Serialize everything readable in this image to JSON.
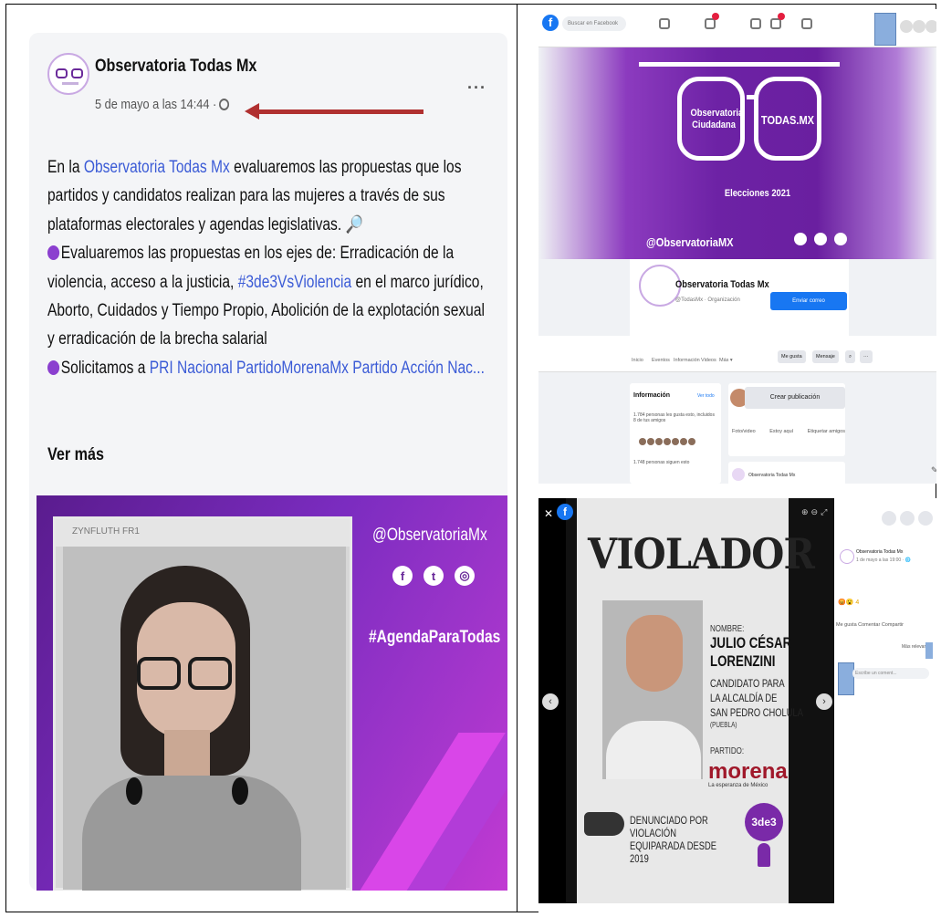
{
  "post": {
    "page_name": "Observatoria Todas Mx",
    "date": "5 de mayo a las 14:44 ·",
    "more_label": "···",
    "line1_pre": "En la ",
    "line1_link": "Observatoria Todas Mx",
    "line1_post": " evaluaremos las propuestas que los",
    "line2": "partidos y candidatos realizan para las mujeres a través de sus",
    "line3": "plataformas electorales y agendas legislativas. 🔎",
    "line4": "Evaluaremos las propuestas en los ejes de: Erradicación de la",
    "line5_pre": "violencia, acceso a la justicia, ",
    "line5_link": "#3de3VsViolencia",
    "line5_post": " en el marco jurídico,",
    "line6": "Aborto, Cuidados y Tiempo Propio, Abolición de la explotación sexual",
    "line7": "y erradicación de la brecha salarial",
    "line8_pre": "Solicitamos a ",
    "line8_link": "PRI Nacional PartidoMorenaMx Partido Acción Nac...",
    "see_more": "Ver más",
    "image_handle": "@ObservatoriaMx",
    "image_hashtag": "#AgendaParaTodas",
    "video_bar_text": "ZYNFLUTH FR1"
  },
  "fb_page": {
    "search_placeholder": "Buscar en Facebook",
    "cover_text_left": "Observatoria Ciudadana",
    "cover_text_right": "TODAS.MX",
    "cover_year": "Elecciones 2021",
    "cover_handle": "@ObservatoriaMX",
    "page_name": "Observatoria Todas Mx",
    "page_sub": "@TodasMx · Organización",
    "send_button": "Enviar correo",
    "tabs": [
      "Inicio",
      "Eventos",
      "Información",
      "Videos",
      "Más ▾"
    ],
    "like_button": "Me gusta",
    "message_button": "Mensaje",
    "info_title": "Información",
    "info_link": "Ver todo",
    "info_line1": "1.784 personas les gusta esto, incluidos 8 de tus amigos",
    "info_line2": "1.748 personas siguen esto",
    "create_post": "Crear publicación",
    "action_photo": "Foto/video",
    "action_here": "Estoy aquí",
    "action_tag": "Etiquetar amigos",
    "post_card_name": "Observatoria Todas Mx"
  },
  "viewer": {
    "poster_title": "VIOLADOR",
    "name_label": "NOMBRE:",
    "name_line1": "JULIO CÉSAR",
    "name_line2": "LORENZINI",
    "candidate_line1": "CANDIDATO PARA",
    "candidate_line2": "LA ALCALDÍA DE",
    "candidate_line3": "SAN PEDRO CHOLULA",
    "state": "(PUEBLA)",
    "party_label": "PARTIDO:",
    "party": "morena",
    "party_sub": "La esperanza de México",
    "denounce_line1": "DENUNCIADO POR VIOLACIÓN",
    "denounce_line2": "EQUIPARADA DESDE 2019",
    "badge": "3de3",
    "panel_name": "Observatoria Todas Mx",
    "panel_date": "1 de mayo a las 19:00 · 🌐",
    "panel_reactions": "😡😮 4",
    "panel_actions": "Me gusta  Comentar  Compartir",
    "panel_relevant": "Más relevantes",
    "panel_comment_placeholder": "Escribe un coment..."
  },
  "colors": {
    "link": "#3b5bd6",
    "purple": "#7b2cc0",
    "arrow": "#b03030",
    "fb_blue": "#1877f2",
    "morena": "#a0182a"
  }
}
